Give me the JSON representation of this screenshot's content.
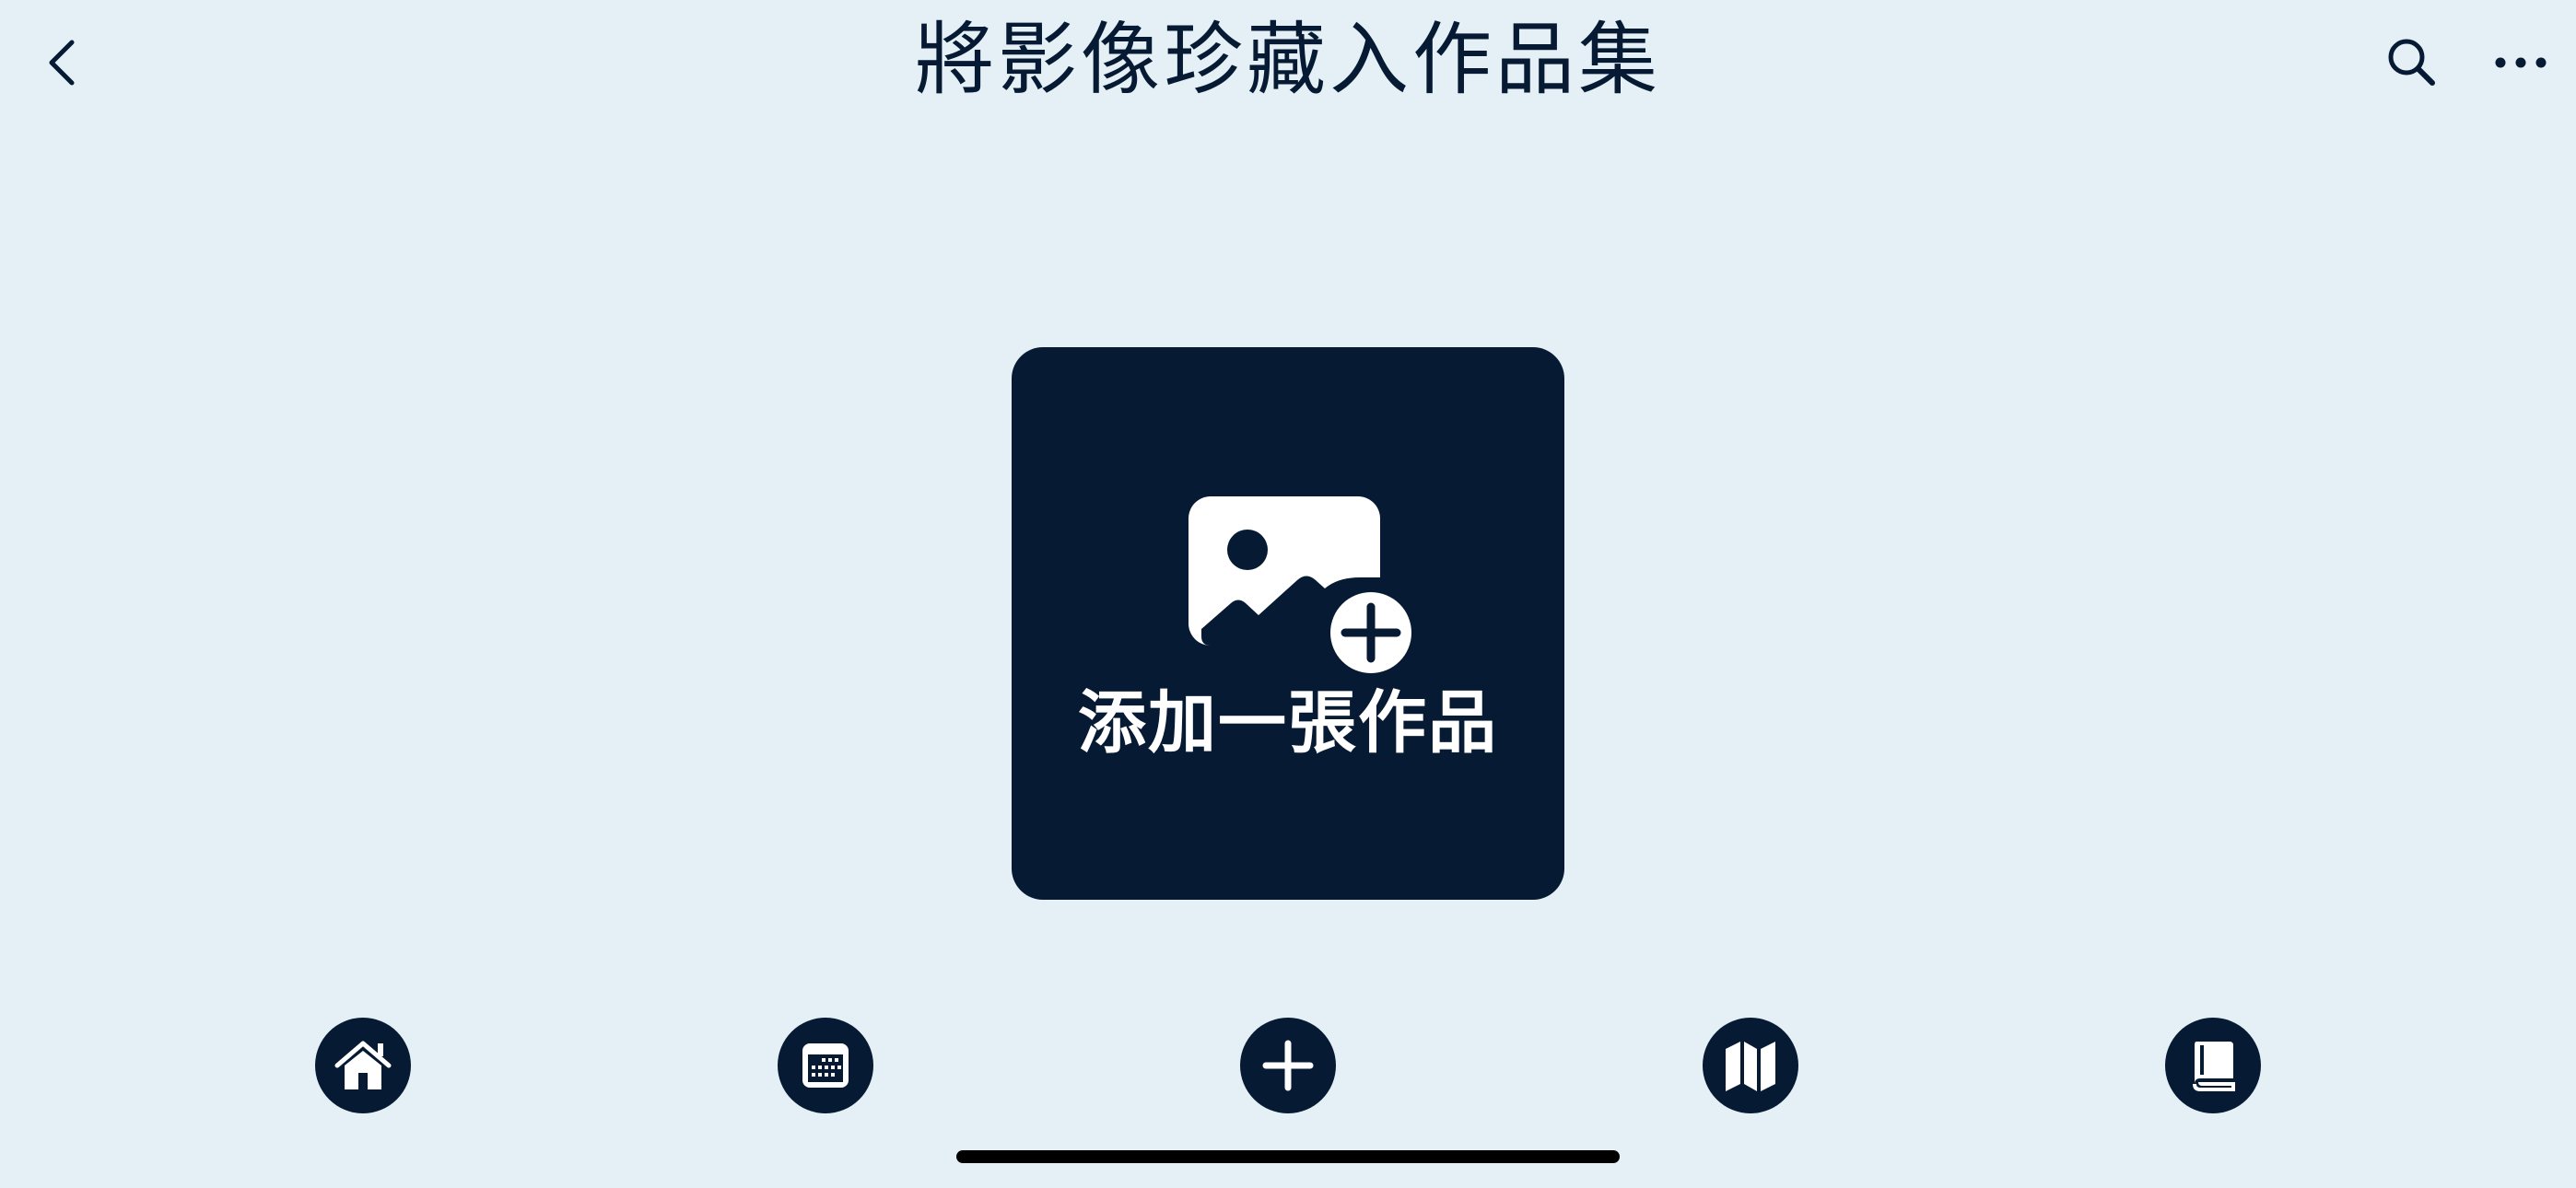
{
  "header": {
    "title": "將影像珍藏入作品集",
    "back_icon": "chevron-left-icon",
    "search_icon": "search-icon",
    "more_icon": "ellipsis-icon"
  },
  "main": {
    "add_card": {
      "label": "添加一張作品",
      "icon": "photo-add-icon"
    }
  },
  "tabbar": {
    "items": [
      {
        "name": "home",
        "icon": "home-icon"
      },
      {
        "name": "calendar",
        "icon": "calendar-icon"
      },
      {
        "name": "add",
        "icon": "plus-icon"
      },
      {
        "name": "map",
        "icon": "map-icon"
      },
      {
        "name": "book",
        "icon": "book-icon"
      }
    ]
  },
  "colors": {
    "background": "#e4f0f5",
    "primary": "#061a33",
    "on_primary": "#ffffff"
  }
}
